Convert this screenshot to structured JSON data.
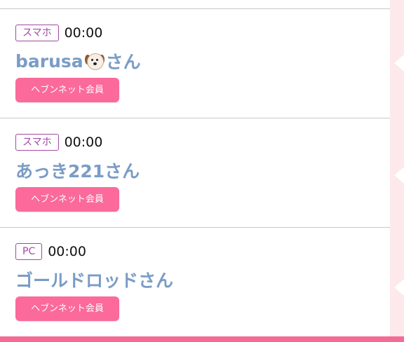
{
  "entries": [
    {
      "device": "スマホ",
      "time": "00:00",
      "name_prefix": "barusa",
      "name_icon": "dog-emoji-icon",
      "name_suffix": "さん",
      "badge": "ヘブンネット会員"
    },
    {
      "device": "スマホ",
      "time": "00:00",
      "name": "あっき221さん",
      "badge": "ヘブンネット会員"
    },
    {
      "device": "PC",
      "time": "00:00",
      "name": "ゴールドロッドさん",
      "badge": "ヘブンネット会員"
    }
  ],
  "colors": {
    "device_border": "#a24aa2",
    "name": "#7a9cc6",
    "badge": "#fb6a9b",
    "side_strip": "#fde8ec",
    "bottom_bar": "#f36b96"
  }
}
